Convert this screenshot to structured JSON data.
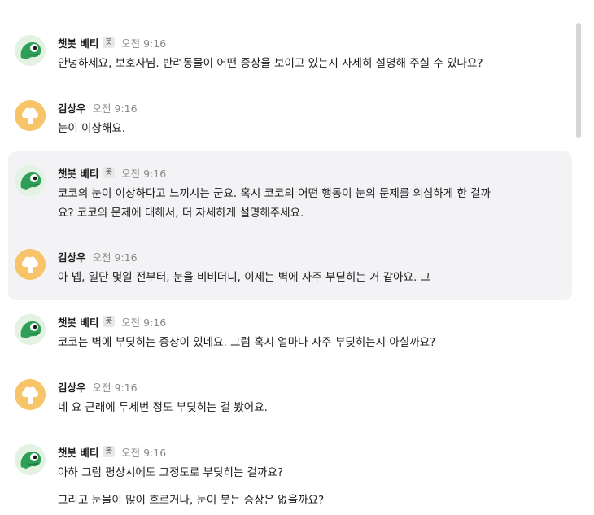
{
  "messages": [
    {
      "sender": "챗봇 베티",
      "badge": "봇",
      "time": "오전 9:16",
      "text": "안녕하세요, 보호자님. 반려동물이 어떤 증상을 보이고 있는지 자세히 설명해 주실 수 있나요?"
    },
    {
      "sender": "김상우",
      "time": "오전 9:16",
      "text": "눈이 이상해요."
    },
    {
      "sender": "챗봇 베티",
      "badge": "봇",
      "time": "오전 9:16",
      "text": "코코의 눈이 이상하다고 느끼시는 군요. 혹시 코코의 어떤 행동이 눈의 문제를 의심하게 한 걸까\n요? 코코의 문제에 대해서, 더 자세하게 설명해주세요."
    },
    {
      "sender": "김상우",
      "time": "오전 9:16",
      "text": "아 넵, 일단 몇일 전부터, 눈을 비비더니, 이제는 벽에 자주 부딛히는 거 같아요. 그"
    },
    {
      "sender": "챗봇 베티",
      "badge": "봇",
      "time": "오전 9:16",
      "text": "코코는 벽에 부딪히는 증상이 있네요. 그럼 혹시 얼마나 자주 부딪히는지 아실까요?"
    },
    {
      "sender": "김상우",
      "time": "오전 9:16",
      "text": "네 요 근래에 두세번 정도 부딪히는 걸 봤어요."
    },
    {
      "sender": "챗봇 베티",
      "badge": "봇",
      "time": "오전 9:16",
      "text": "아하 그럼 평상시에도 그정도로 부딪히는 걸까요?",
      "text2": "그리고 눈물이 많이 흐르거나, 눈이 붓는 증상은 없을까요?"
    }
  ],
  "icons": {
    "bot_avatar": "chameleon-avatar-icon",
    "user_avatar": "user-avatar-icon"
  },
  "colors": {
    "highlight_bg": "#f3f3f5",
    "user_avatar_bg": "#f7c46a",
    "bot_green": "#2f9e57"
  }
}
